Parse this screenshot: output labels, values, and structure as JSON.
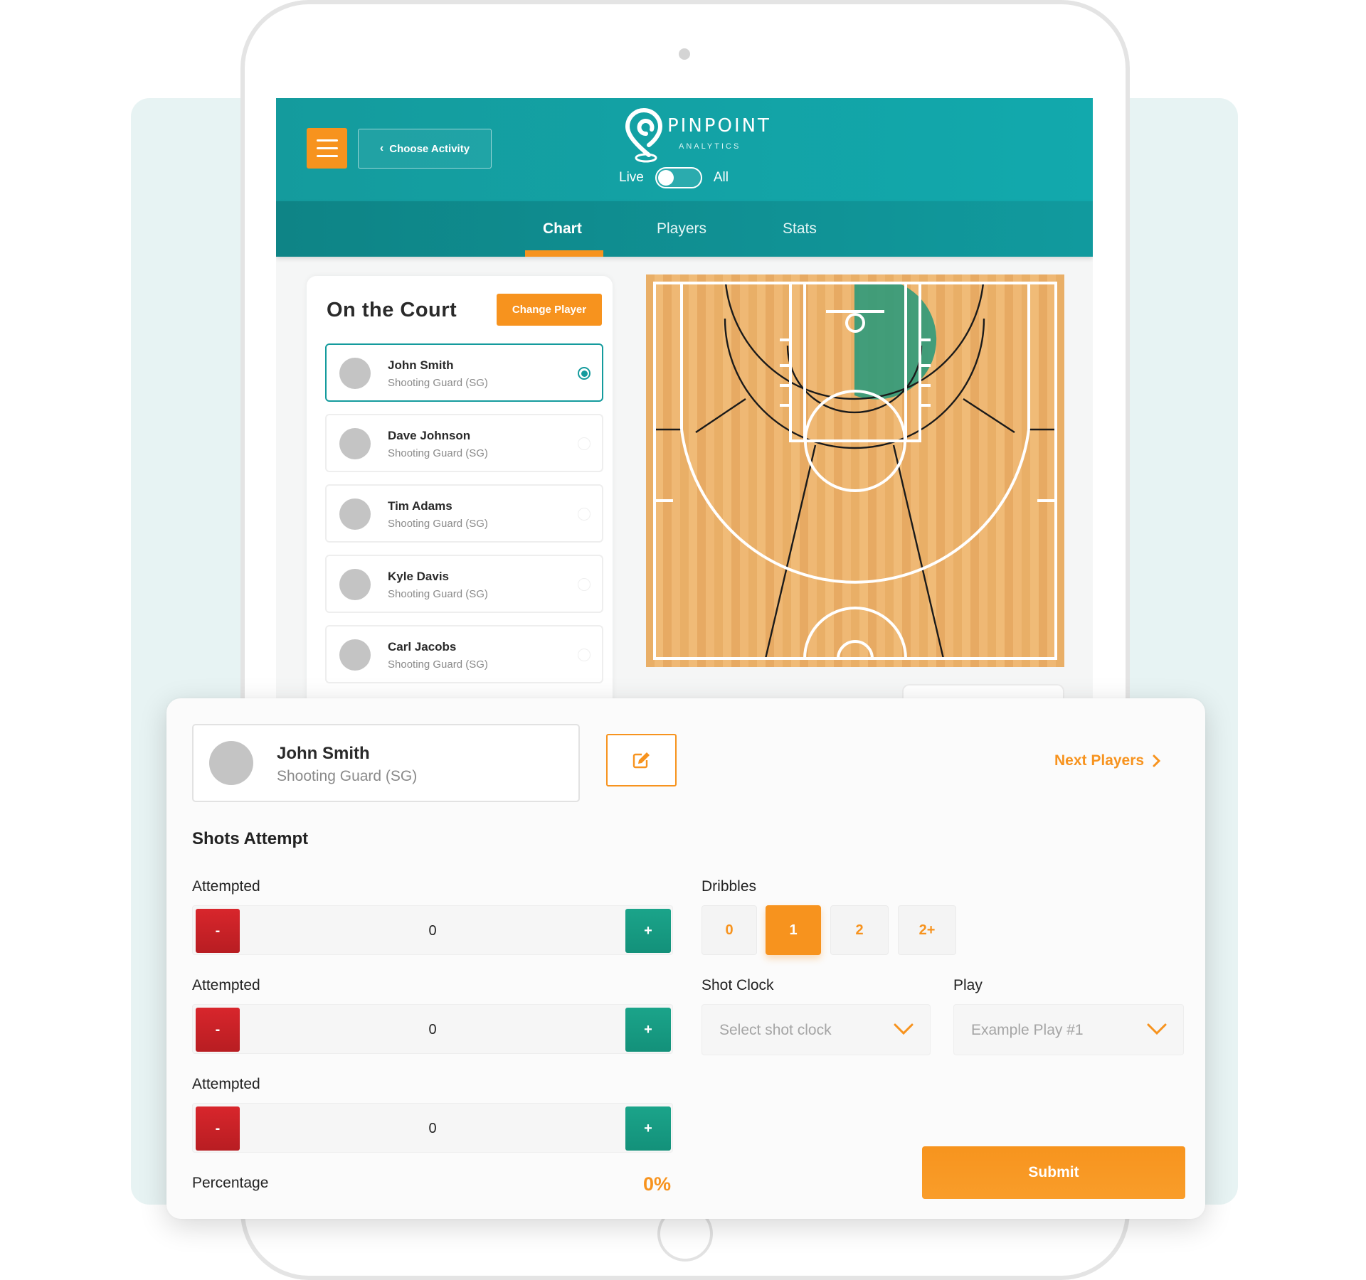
{
  "app": {
    "brand": "PINPOINT",
    "brand_sub": "ANALYTICS",
    "choose_activity": "Choose Activity",
    "toggle_left": "Live",
    "toggle_right": "All"
  },
  "tabs": [
    {
      "label": "Chart",
      "active": true
    },
    {
      "label": "Players",
      "active": false
    },
    {
      "label": "Stats",
      "active": false
    }
  ],
  "on_court": {
    "title": "On the Court",
    "change_player": "Change Player",
    "players": [
      {
        "name": "John Smith",
        "role": "Shooting Guard (SG)",
        "selected": true
      },
      {
        "name": "Dave Johnson",
        "role": "Shooting Guard (SG)",
        "selected": false
      },
      {
        "name": "Tim Adams",
        "role": "Shooting Guard (SG)",
        "selected": false
      },
      {
        "name": "Kyle Davis",
        "role": "Shooting Guard (SG)",
        "selected": false
      },
      {
        "name": "Carl Jacobs",
        "role": "Shooting Guard (SG)",
        "selected": false
      }
    ]
  },
  "panel": {
    "player": {
      "name": "John Smith",
      "role": "Shooting Guard (SG)"
    },
    "next_players": "Next Players",
    "section_title": "Shots Attempt",
    "steppers": [
      {
        "label": "Attempted",
        "value": "0",
        "minus": "-",
        "plus": "+"
      },
      {
        "label": "Attempted",
        "value": "0",
        "minus": "-",
        "plus": "+"
      },
      {
        "label": "Attempted",
        "value": "0",
        "minus": "-",
        "plus": "+"
      }
    ],
    "percentage_label": "Percentage",
    "percentage_value": "0%",
    "dribbles": {
      "label": "Dribbles",
      "options": [
        "0",
        "1",
        "2",
        "2+"
      ],
      "selected": "1"
    },
    "shot_clock": {
      "label": "Shot Clock",
      "placeholder": "Select shot clock"
    },
    "play": {
      "label": "Play",
      "placeholder": "Example Play #1"
    },
    "submit": "Submit"
  },
  "colors": {
    "teal": "#149b9d",
    "orange": "#f7931e",
    "red": "#c8242a",
    "green": "#18a085",
    "court_zone": "#2f9a7a"
  }
}
